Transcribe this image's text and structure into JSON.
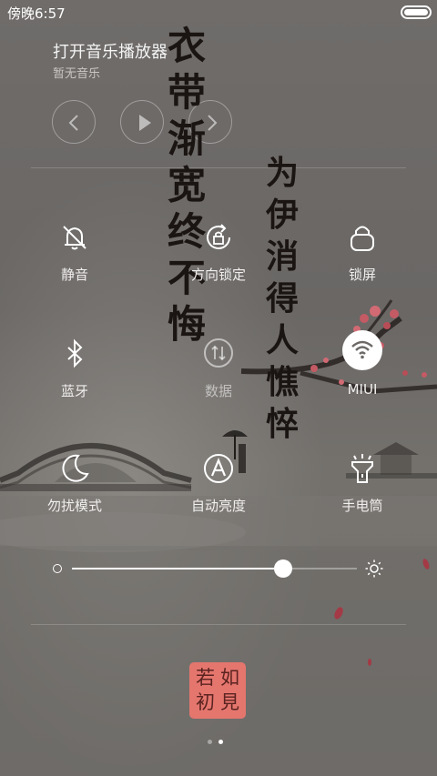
{
  "status_bar": {
    "time": "傍晚6:57"
  },
  "music": {
    "title": "打开音乐播放器",
    "subtitle": "暂无音乐",
    "controls": [
      "previous-icon",
      "play-icon",
      "next-icon"
    ]
  },
  "calligraphy": {
    "column1": [
      "衣",
      "带",
      "渐",
      "宽",
      "终",
      "不",
      "悔"
    ],
    "column2": [
      "为",
      "伊",
      "消",
      "得",
      "人",
      "憔",
      "悴"
    ]
  },
  "toggles": [
    {
      "label": "静音",
      "icon": "bell-muted-icon",
      "active": false
    },
    {
      "label": "方向锁定",
      "icon": "rotation-lock-icon",
      "active": false
    },
    {
      "label": "锁屏",
      "icon": "lock-icon",
      "active": false
    },
    {
      "label": "蓝牙",
      "icon": "bluetooth-icon",
      "active": false
    },
    {
      "label": "数据",
      "icon": "mobile-data-icon",
      "active": false,
      "dimmed": true
    },
    {
      "label": "MIUI",
      "icon": "wifi-icon",
      "active": true
    },
    {
      "label": "勿扰模式",
      "icon": "moon-icon",
      "active": false
    },
    {
      "label": "自动亮度",
      "icon": "auto-brightness-icon",
      "active": false
    },
    {
      "label": "手电筒",
      "icon": "flashlight-icon",
      "active": false
    }
  ],
  "brightness": {
    "level": 0.74
  },
  "seal": {
    "chars": [
      "若",
      "如",
      "初",
      "見"
    ],
    "color": "#e4766e"
  },
  "pager": {
    "count": 2,
    "active_index": 1
  },
  "colors": {
    "accent": "#ffffff",
    "background": "#6b6866"
  }
}
